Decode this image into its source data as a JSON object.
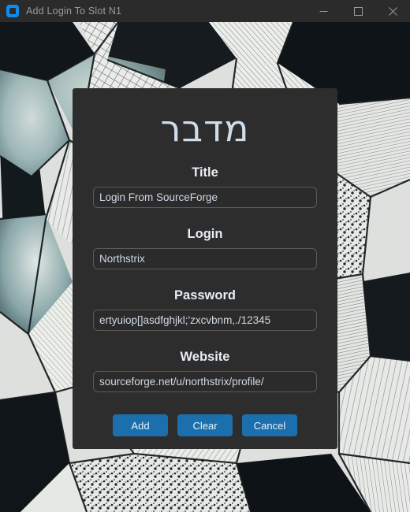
{
  "window": {
    "title": "Add Login To Slot N1",
    "icon": "app-logo-icon",
    "controls": {
      "minimize": "minimize-icon",
      "maximize": "maximize-icon",
      "close": "close-icon"
    }
  },
  "dialog": {
    "hero_title": "מדבר",
    "fields": [
      {
        "label": "Title",
        "value": "Login From SourceForge"
      },
      {
        "label": "Login",
        "value": "Northstrix"
      },
      {
        "label": "Password",
        "value": "ertyuiop[]asdfghjkl;'zxcvbnm,./12345"
      },
      {
        "label": "Website",
        "value": "sourceforge.net/u/northstrix/profile/"
      }
    ],
    "buttons": {
      "add": "Add",
      "clear": "Clear",
      "cancel": "Cancel"
    }
  },
  "colors": {
    "titlebar_bg": "#2b2b2b",
    "titlebar_text": "#9a9a9a",
    "icon_blue": "#0b8ef0",
    "dialog_bg": "#2d2d2d",
    "hero_text": "#cfdcea",
    "label_text": "#e8eef4",
    "input_bg": "#2b2b2b",
    "input_border": "#5a5a5a",
    "input_text": "#cfd9e4",
    "button_bg": "#1b6fad",
    "button_text": "#e9f1f8"
  }
}
